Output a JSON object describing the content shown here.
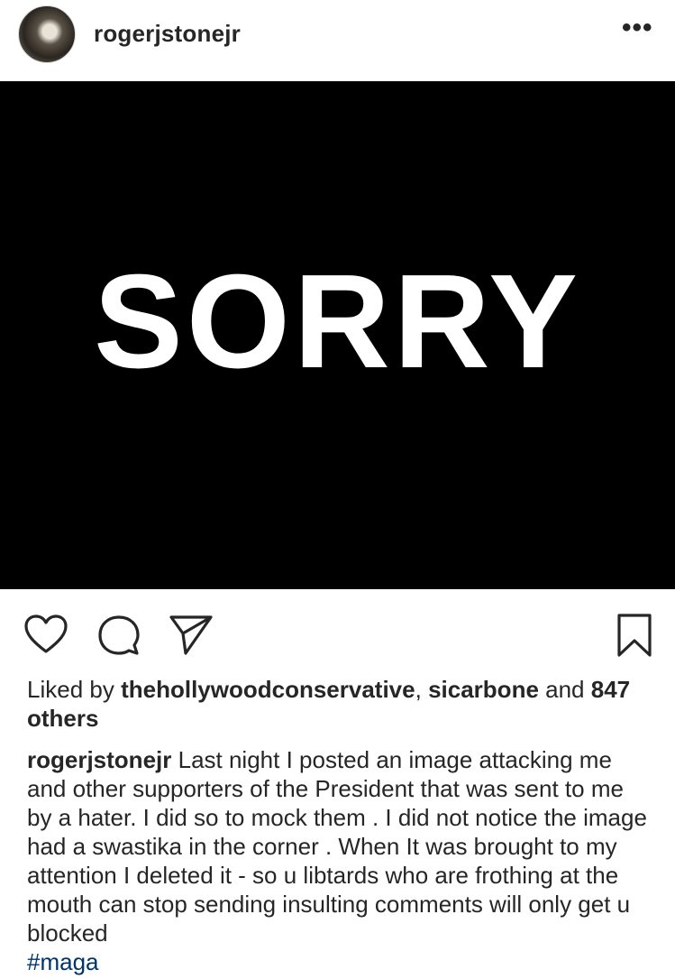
{
  "post": {
    "username": "rogerjstonejr",
    "more_icon": "more-dots-icon",
    "image_text": "SORRY",
    "actions": {
      "like": "heart-icon",
      "comment": "comment-icon",
      "share": "paper-plane-icon",
      "save": "bookmark-icon"
    },
    "likes": {
      "prefix": "Liked by",
      "user1": "thehollywoodconservative",
      "separator": ",",
      "user2": "sicarbone",
      "conjunction": "and",
      "others": "847 others"
    },
    "caption": {
      "username": "rogerjstonejr",
      "text": "Last night I posted an image attacking me and other supporters of the President that was sent to me by a hater. I did so to mock them . I did not notice the image had a swastika in the corner . When It was brought to my attention I deleted it - so u libtards who are frothing at the mouth can stop sending insulting comments will only get u blocked",
      "hashtag": "#maga"
    }
  }
}
